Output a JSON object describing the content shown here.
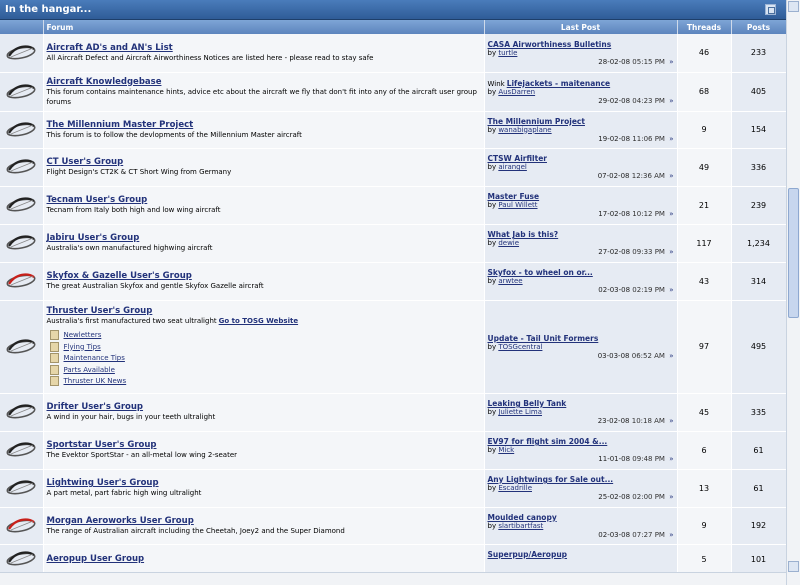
{
  "category": {
    "title": "In the hangar..."
  },
  "columns": {
    "forum": "Forum",
    "last_post": "Last Post",
    "threads": "Threads",
    "posts": "Posts"
  },
  "date_suffix": "»",
  "forums": [
    {
      "title": "Aircraft AD's and AN's List",
      "desc": "All Aircraft Defect and Aircraft Airworthiness Notices are listed here - please read to stay safe",
      "lp_prefix": "",
      "lp_title": "CASA Airworthiness Bulletins",
      "lp_user": "turtle",
      "lp_date": "28-02-08",
      "lp_time": "05:15 PM",
      "threads": "46",
      "posts": "233",
      "icon": "plane"
    },
    {
      "title": "Aircraft Knowledgebase",
      "desc": "This forum contains maintenance hints, advice etc about the aircraft we fly that don't fit into any of the aircraft user group forums",
      "lp_prefix": "Wink",
      "lp_title": "Lifejackets - maitenance",
      "lp_user": "AusDarren",
      "lp_date": "29-02-08",
      "lp_time": "04:23 PM",
      "threads": "68",
      "posts": "405",
      "icon": "plane"
    },
    {
      "title": "The Millennium Master Project",
      "desc": "This forum is to follow the devlopments of the Millennium Master aircraft",
      "lp_prefix": "",
      "lp_title": "The Millennium Project",
      "lp_user": "wanabigaplane",
      "lp_date": "19-02-08",
      "lp_time": "11:06 PM",
      "threads": "9",
      "posts": "154",
      "icon": "plane"
    },
    {
      "title": "CT User's Group",
      "desc": "Flight Design's CT2K & CT Short Wing from Germany",
      "lp_prefix": "",
      "lp_title": "CTSW Airfilter",
      "lp_user": "airangel",
      "lp_date": "07-02-08",
      "lp_time": "12:36 AM",
      "threads": "49",
      "posts": "336",
      "icon": "plane"
    },
    {
      "title": "Tecnam User's Group",
      "desc": "Tecnam from Italy both high and low wing aircraft",
      "lp_prefix": "",
      "lp_title": "Master Fuse",
      "lp_user": "Paul Willett",
      "lp_date": "17-02-08",
      "lp_time": "10:12 PM",
      "threads": "21",
      "posts": "239",
      "icon": "plane"
    },
    {
      "title": "Jabiru User's Group",
      "desc": "Australia's own manufactured highwing aircraft",
      "lp_prefix": "",
      "lp_title": "What Jab is this?",
      "lp_user": "dewie",
      "lp_date": "27-02-08",
      "lp_time": "09:33 PM",
      "threads": "117",
      "posts": "1,234",
      "icon": "plane"
    },
    {
      "title": "Skyfox & Gazelle User's Group",
      "desc": "The great Australian Skyfox and gentle Skyfox Gazelle aircraft",
      "lp_prefix": "",
      "lp_title": "Skyfox - to wheel on or...",
      "lp_user": "arwtee",
      "lp_date": "02-03-08",
      "lp_time": "02:19 PM",
      "threads": "43",
      "posts": "314",
      "icon": "plane-red"
    },
    {
      "title": "Thruster User's Group",
      "desc": "Australia's first manufactured two seat ultralight",
      "desc_link": "Go to TOSG Website",
      "subforums": [
        "Newletters",
        "Flying Tips",
        "Maintenance Tips",
        "Parts Available",
        "Thruster UK News"
      ],
      "lp_prefix": "",
      "lp_title": "Update - Tail Unit Formers",
      "lp_user": "TOSGcentral",
      "lp_date": "03-03-08",
      "lp_time": "06:52 AM",
      "threads": "97",
      "posts": "495",
      "icon": "plane"
    },
    {
      "title": "Drifter User's Group",
      "desc": "A wind in your hair, bugs in your teeth ultralight",
      "lp_prefix": "",
      "lp_title": "Leaking Belly Tank",
      "lp_user": "Juliette Lima",
      "lp_date": "23-02-08",
      "lp_time": "10:18 AM",
      "threads": "45",
      "posts": "335",
      "icon": "plane"
    },
    {
      "title": "Sportstar User's Group",
      "desc": "The Evektor SportStar - an all-metal low wing 2-seater",
      "lp_prefix": "",
      "lp_title": "EV97 for flight sim 2004 &...",
      "lp_user": "Mick",
      "lp_date": "11-01-08",
      "lp_time": "09:48 PM",
      "threads": "6",
      "posts": "61",
      "icon": "plane"
    },
    {
      "title": "Lightwing User's Group",
      "desc": "A part metal, part fabric high wing ultralight",
      "lp_prefix": "",
      "lp_title": "Any Lightwings for Sale out...",
      "lp_user": "Escadrille",
      "lp_date": "25-02-08",
      "lp_time": "02:00 PM",
      "threads": "13",
      "posts": "61",
      "icon": "plane"
    },
    {
      "title": "Morgan Aeroworks User Group",
      "desc": "The range of Australian aircraft including the Cheetah, Joey2 and the Super Diamond",
      "lp_prefix": "",
      "lp_title": "Moulded canopy",
      "lp_user": "slartibartfast",
      "lp_date": "02-03-08",
      "lp_time": "07:27 PM",
      "threads": "9",
      "posts": "192",
      "icon": "plane-red"
    },
    {
      "title": "Aeropup User Group",
      "desc": "",
      "lp_prefix": "",
      "lp_title": "Superpup/Aeropup",
      "lp_user": "",
      "lp_date": "",
      "lp_time": "",
      "threads": "5",
      "posts": "101",
      "icon": "plane"
    }
  ],
  "row_labels": {
    "by": "by"
  }
}
